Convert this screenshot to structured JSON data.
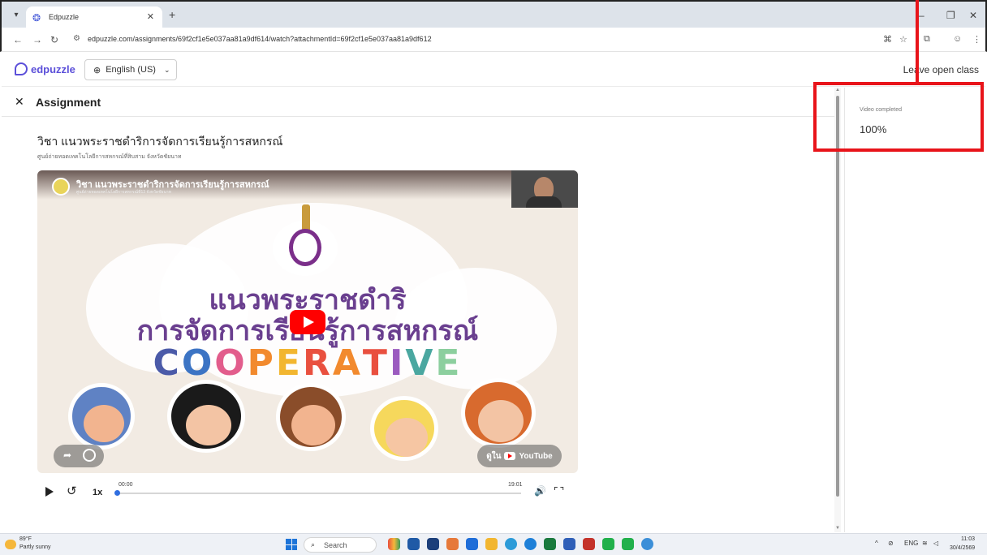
{
  "browser": {
    "tab_title": "Edpuzzle",
    "url": "edpuzzle.com/assignments/69f2cf1e5e037aa81a9df614/watch?attachmentId=69f2cf1e5e037aa81a9df612"
  },
  "header": {
    "logo_text": "edpuzzle",
    "language": "English (US)",
    "leave_link": "Leave open class"
  },
  "assignment": {
    "heading": "Assignment",
    "video_title": "วิชา แนวพระราชดำริการจัดการเรียนรู้การสหกรณ์",
    "video_subtitle": "ศูนย์ถ่ายทอดเทคโนโลยีการสหกรณ์ที่สิบสาม จังหวัดชัยนาท"
  },
  "player": {
    "yt_title": "วิชา แนวพระราชดำริการจัดการเรียนรู้การสหกรณ์",
    "yt_channel": "ศูนย์ถ่ายทอดเทคโนโลยีการสหกรณ์ที่13 จังหวัดชัยนาท",
    "thai_line_1": "แนวพระราชดำริ",
    "thai_line_2": "การจัดการเรียนรู้การสหกรณ์",
    "cooperative_letters": [
      {
        "ch": "C",
        "color": "#4b5aa8"
      },
      {
        "ch": "O",
        "color": "#3c74c4"
      },
      {
        "ch": "O",
        "color": "#e25d8c"
      },
      {
        "ch": "P",
        "color": "#f28a2e"
      },
      {
        "ch": "E",
        "color": "#f2b630"
      },
      {
        "ch": "R",
        "color": "#e9503f"
      },
      {
        "ch": "A",
        "color": "#f28a2e"
      },
      {
        "ch": "T",
        "color": "#e9503f"
      },
      {
        "ch": "I",
        "color": "#9b5bbf"
      },
      {
        "ch": "V",
        "color": "#4aa7a0"
      },
      {
        "ch": "E",
        "color": "#8ccf9e"
      }
    ],
    "watch_on_prefix": "ดูใน",
    "watch_on_brand": "YouTube",
    "time_current": "00:00",
    "time_total": "19:01",
    "speed": "1x",
    "progress_fraction": 0.0
  },
  "side_panel": {
    "label": "Video completed",
    "value": "100%"
  },
  "taskbar": {
    "temperature": "89°F",
    "weather": "Partly sunny",
    "search_placeholder": "Search",
    "language_indicator": "ENG",
    "time": "11:03",
    "date": "30/4/2569"
  },
  "colors": {
    "brand": "#5b4fd9",
    "highlight": "#e8141a",
    "progress": "#2f6ee0"
  }
}
